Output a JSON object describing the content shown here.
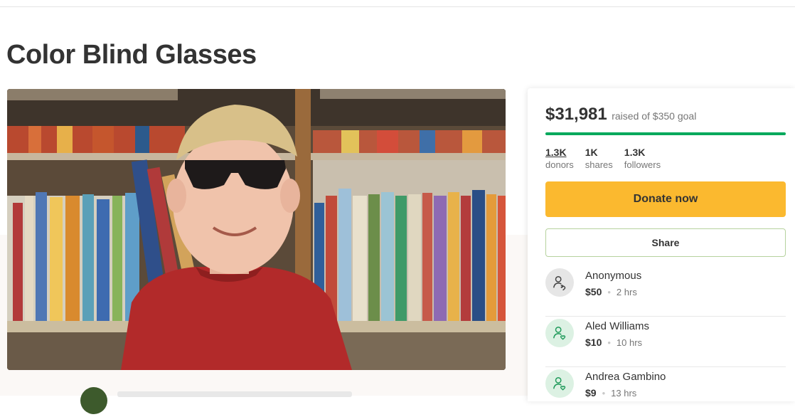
{
  "campaign": {
    "title": "Color Blind Glasses"
  },
  "fundraising": {
    "raised": "$31,981",
    "goal_text": "raised of $350 goal",
    "progress_fraction": 1.0,
    "stats": [
      {
        "value": "1.3K",
        "label": "donors"
      },
      {
        "value": "1K",
        "label": "shares"
      },
      {
        "value": "1.3K",
        "label": "followers"
      }
    ],
    "donate_label": "Donate now",
    "share_label": "Share",
    "accent_color": "#02a95c",
    "button_color": "#fbb92f"
  },
  "donations": [
    {
      "name": "Anonymous",
      "amount": "$50",
      "time": "2 hrs",
      "icon": "donor-anonymous-icon"
    },
    {
      "name": "Aled Williams",
      "amount": "$10",
      "time": "10 hrs",
      "icon": "donor-icon"
    },
    {
      "name": "Andrea Gambino",
      "amount": "$9",
      "time": "13 hrs",
      "icon": "donor-icon"
    }
  ]
}
